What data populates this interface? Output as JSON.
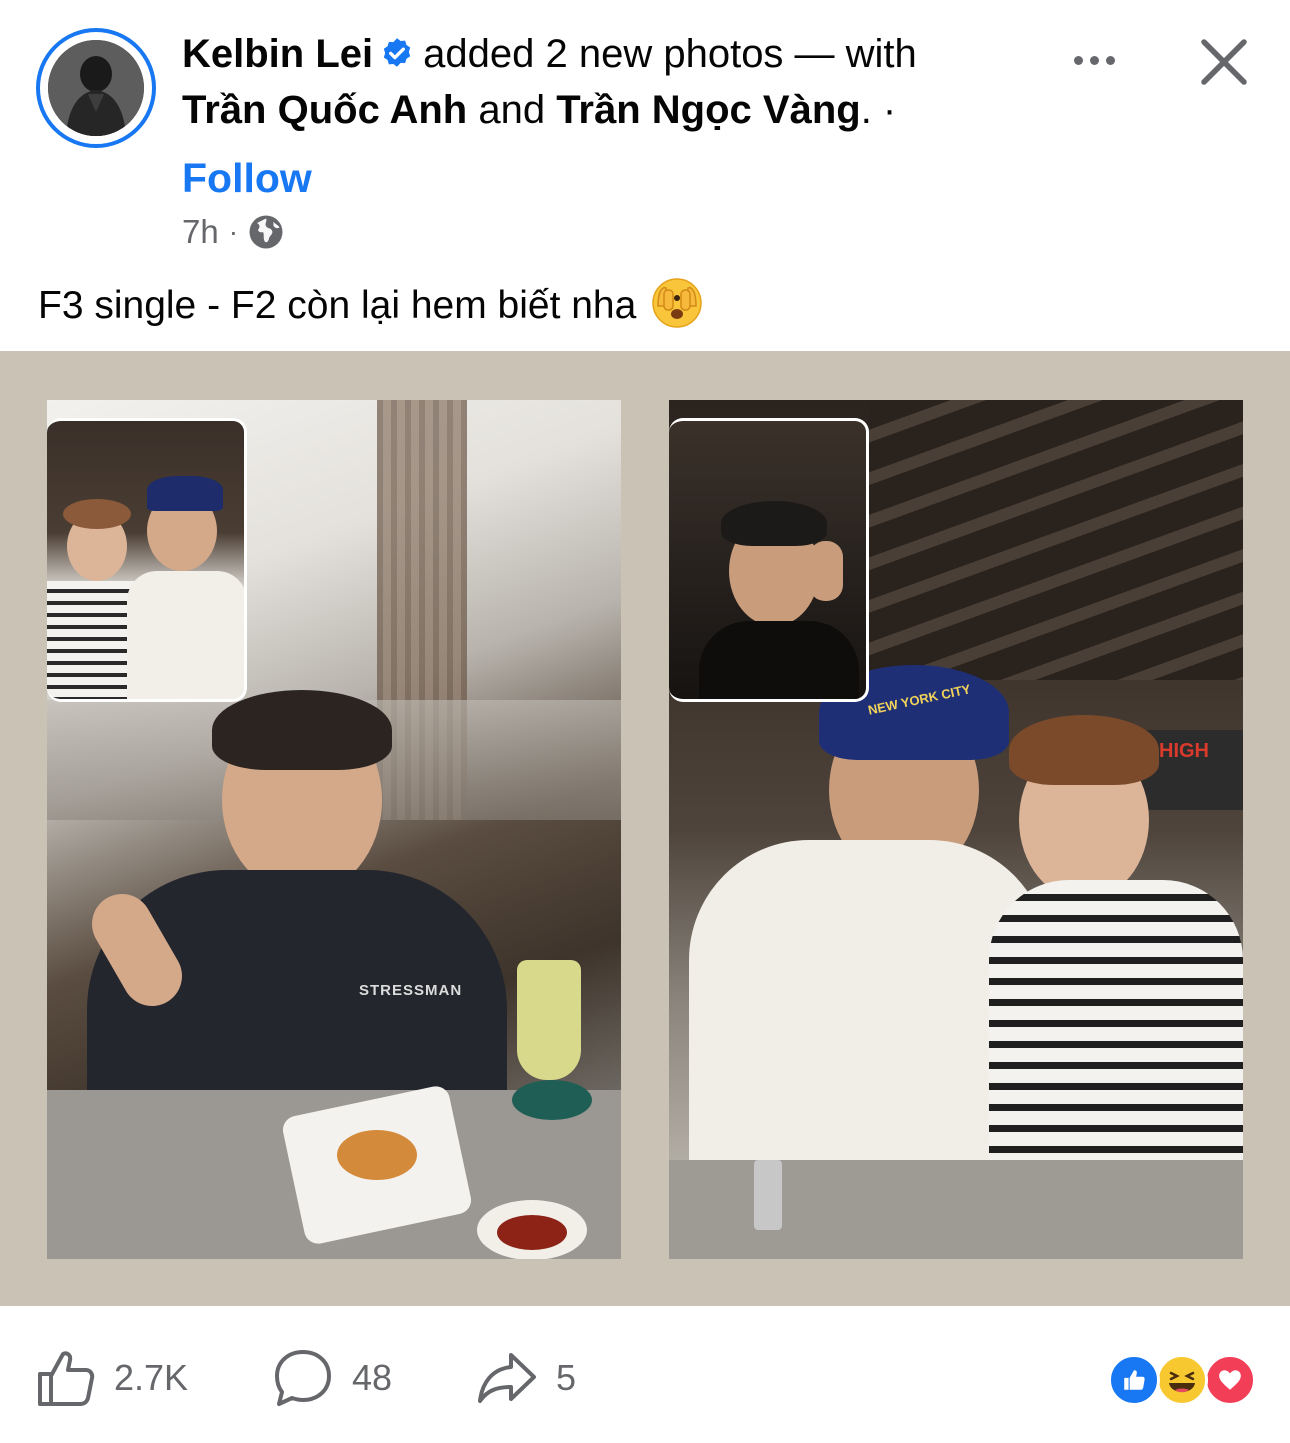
{
  "post": {
    "author": "Kelbin Lei",
    "action_text": "added 2 new photos — with",
    "tagged_1": "Trần Quốc Anh",
    "and_text": "and",
    "tagged_2": "Trần Ngọc Vàng",
    "trail": ". ·",
    "follow_label": "Follow",
    "time": "7h",
    "meta_sep": "·",
    "caption": "F3 single -  F2 còn lại hem biết nha"
  },
  "photos": [
    {
      "shirt_text": "STRESSMAN"
    },
    {
      "cap_text": "NEW YORK CITY"
    }
  ],
  "footer": {
    "likes": "2.7K",
    "comments": "48",
    "shares": "5"
  },
  "icons": {
    "verified": "verified-badge-icon",
    "more": "more-options-icon",
    "close": "close-icon",
    "privacy": "globe-icon",
    "emoji": "face-with-peeking-eye-emoji",
    "like": "like-icon",
    "comment": "comment-icon",
    "share": "share-icon"
  },
  "colors": {
    "accent": "#1877f2",
    "secondary_text": "#65676b",
    "photo_bg": "#c9c2b5",
    "love": "#f33e58",
    "haha": "#f7c82f"
  }
}
